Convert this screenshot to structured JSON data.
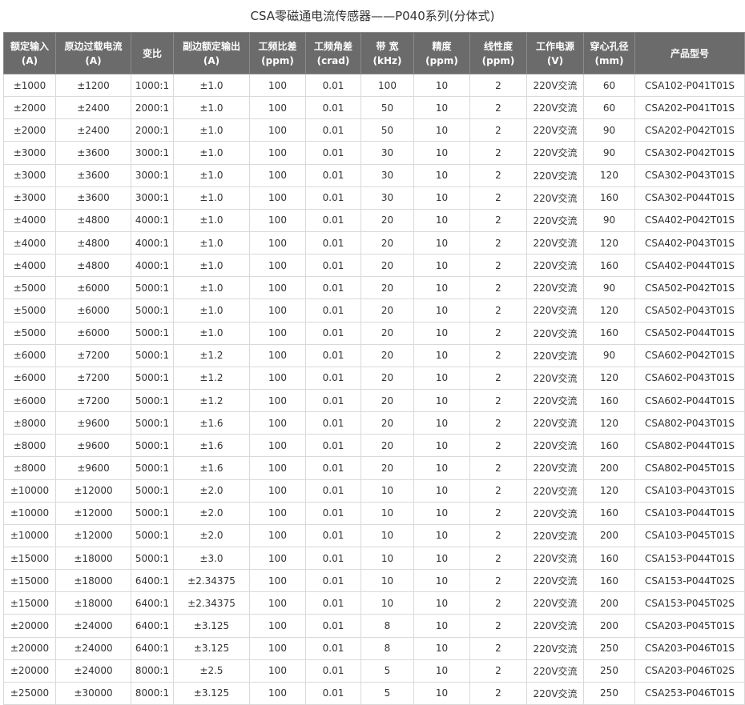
{
  "title": "CSA零磁通电流传感器——P040系列(分体式)",
  "table": {
    "headers": [
      {
        "line1": "额定输入",
        "line2": "(A)"
      },
      {
        "line1": "原边过载电流",
        "line2": "(A)"
      },
      {
        "line1": "变比",
        "line2": ""
      },
      {
        "line1": "副边额定输出",
        "line2": "(A)"
      },
      {
        "line1": "工频比差",
        "line2": "(ppm)"
      },
      {
        "line1": "工频角差",
        "line2": "(crad)"
      },
      {
        "line1": "带 宽",
        "line2": "(kHz)"
      },
      {
        "line1": "精度",
        "line2": "(ppm)"
      },
      {
        "line1": "线性度",
        "line2": "(ppm)"
      },
      {
        "line1": "工作电源",
        "line2": "(V)"
      },
      {
        "line1": "穿心孔径",
        "line2": "(mm)"
      },
      {
        "line1": "产品型号",
        "line2": ""
      }
    ],
    "rows": [
      [
        "±1000",
        "±1200",
        "1000:1",
        "±1.0",
        "100",
        "0.01",
        "100",
        "10",
        "2",
        "220V交流",
        "60",
        "CSA102-P041T01S"
      ],
      [
        "±2000",
        "±2400",
        "2000:1",
        "±1.0",
        "100",
        "0.01",
        "50",
        "10",
        "2",
        "220V交流",
        "60",
        "CSA202-P041T01S"
      ],
      [
        "±2000",
        "±2400",
        "2000:1",
        "±1.0",
        "100",
        "0.01",
        "50",
        "10",
        "2",
        "220V交流",
        "90",
        "CSA202-P042T01S"
      ],
      [
        "±3000",
        "±3600",
        "3000:1",
        "±1.0",
        "100",
        "0.01",
        "30",
        "10",
        "2",
        "220V交流",
        "90",
        "CSA302-P042T01S"
      ],
      [
        "±3000",
        "±3600",
        "3000:1",
        "±1.0",
        "100",
        "0.01",
        "30",
        "10",
        "2",
        "220V交流",
        "120",
        "CSA302-P043T01S"
      ],
      [
        "±3000",
        "±3600",
        "3000:1",
        "±1.0",
        "100",
        "0.01",
        "30",
        "10",
        "2",
        "220V交流",
        "160",
        "CSA302-P044T01S"
      ],
      [
        "±4000",
        "±4800",
        "4000:1",
        "±1.0",
        "100",
        "0.01",
        "20",
        "10",
        "2",
        "220V交流",
        "90",
        "CSA402-P042T01S"
      ],
      [
        "±4000",
        "±4800",
        "4000:1",
        "±1.0",
        "100",
        "0.01",
        "20",
        "10",
        "2",
        "220V交流",
        "120",
        "CSA402-P043T01S"
      ],
      [
        "±4000",
        "±4800",
        "4000:1",
        "±1.0",
        "100",
        "0.01",
        "20",
        "10",
        "2",
        "220V交流",
        "160",
        "CSA402-P044T01S"
      ],
      [
        "±5000",
        "±6000",
        "5000:1",
        "±1.0",
        "100",
        "0.01",
        "20",
        "10",
        "2",
        "220V交流",
        "90",
        "CSA502-P042T01S"
      ],
      [
        "±5000",
        "±6000",
        "5000:1",
        "±1.0",
        "100",
        "0.01",
        "20",
        "10",
        "2",
        "220V交流",
        "120",
        "CSA502-P043T01S"
      ],
      [
        "±5000",
        "±6000",
        "5000:1",
        "±1.0",
        "100",
        "0.01",
        "20",
        "10",
        "2",
        "220V交流",
        "160",
        "CSA502-P044T01S"
      ],
      [
        "±6000",
        "±7200",
        "5000:1",
        "±1.2",
        "100",
        "0.01",
        "20",
        "10",
        "2",
        "220V交流",
        "90",
        "CSA602-P042T01S"
      ],
      [
        "±6000",
        "±7200",
        "5000:1",
        "±1.2",
        "100",
        "0.01",
        "20",
        "10",
        "2",
        "220V交流",
        "120",
        "CSA602-P043T01S"
      ],
      [
        "±6000",
        "±7200",
        "5000:1",
        "±1.2",
        "100",
        "0.01",
        "20",
        "10",
        "2",
        "220V交流",
        "160",
        "CSA602-P044T01S"
      ],
      [
        "±8000",
        "±9600",
        "5000:1",
        "±1.6",
        "100",
        "0.01",
        "20",
        "10",
        "2",
        "220V交流",
        "120",
        "CSA802-P043T01S"
      ],
      [
        "±8000",
        "±9600",
        "5000:1",
        "±1.6",
        "100",
        "0.01",
        "20",
        "10",
        "2",
        "220V交流",
        "160",
        "CSA802-P044T01S"
      ],
      [
        "±8000",
        "±9600",
        "5000:1",
        "±1.6",
        "100",
        "0.01",
        "20",
        "10",
        "2",
        "220V交流",
        "200",
        "CSA802-P045T01S"
      ],
      [
        "±10000",
        "±12000",
        "5000:1",
        "±2.0",
        "100",
        "0.01",
        "10",
        "10",
        "2",
        "220V交流",
        "120",
        "CSA103-P043T01S"
      ],
      [
        "±10000",
        "±12000",
        "5000:1",
        "±2.0",
        "100",
        "0.01",
        "10",
        "10",
        "2",
        "220V交流",
        "160",
        "CSA103-P044T01S"
      ],
      [
        "±10000",
        "±12000",
        "5000:1",
        "±2.0",
        "100",
        "0.01",
        "10",
        "10",
        "2",
        "220V交流",
        "200",
        "CSA103-P045T01S"
      ],
      [
        "±15000",
        "±18000",
        "5000:1",
        "±3.0",
        "100",
        "0.01",
        "10",
        "10",
        "2",
        "220V交流",
        "160",
        "CSA153-P044T01S"
      ],
      [
        "±15000",
        "±18000",
        "6400:1",
        "±2.34375",
        "100",
        "0.01",
        "10",
        "10",
        "2",
        "220V交流",
        "160",
        "CSA153-P044T02S"
      ],
      [
        "±15000",
        "±18000",
        "6400:1",
        "±2.34375",
        "100",
        "0.01",
        "10",
        "10",
        "2",
        "220V交流",
        "200",
        "CSA153-P045T02S"
      ],
      [
        "±20000",
        "±24000",
        "6400:1",
        "±3.125",
        "100",
        "0.01",
        "8",
        "10",
        "2",
        "220V交流",
        "200",
        "CSA203-P045T01S"
      ],
      [
        "±20000",
        "±24000",
        "6400:1",
        "±3.125",
        "100",
        "0.01",
        "8",
        "10",
        "2",
        "220V交流",
        "250",
        "CSA203-P046T01S"
      ],
      [
        "±20000",
        "±24000",
        "8000:1",
        "±2.5",
        "100",
        "0.01",
        "5",
        "10",
        "2",
        "220V交流",
        "250",
        "CSA203-P046T02S"
      ],
      [
        "±25000",
        "±30000",
        "8000:1",
        "±3.125",
        "100",
        "0.01",
        "5",
        "10",
        "2",
        "220V交流",
        "250",
        "CSA253-P046T01S"
      ]
    ]
  }
}
